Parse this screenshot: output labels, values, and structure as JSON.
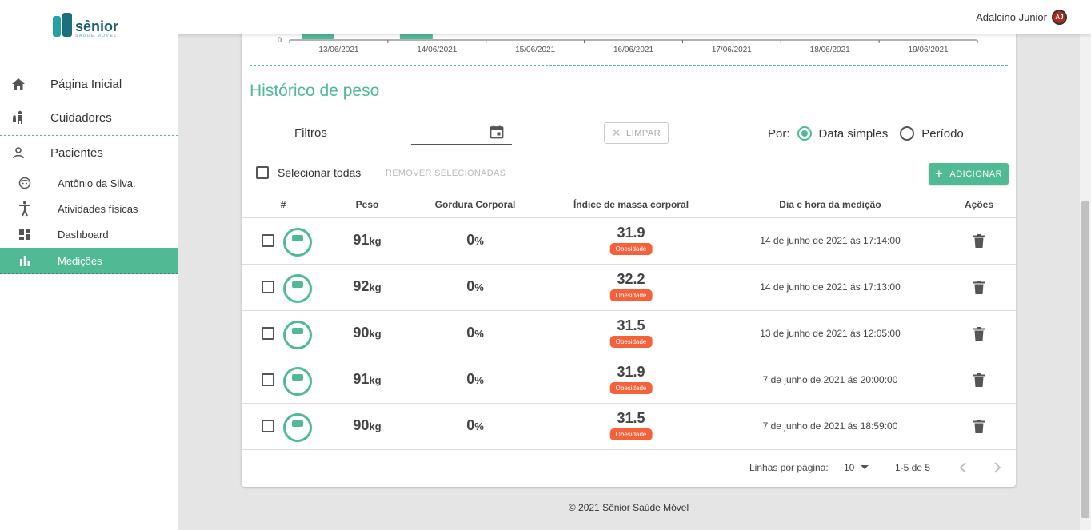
{
  "user": {
    "name": "Adalcino Junior",
    "initials": "AJ"
  },
  "logo": {
    "title": "sênior",
    "subtitle": "SAÚDE MÓVEL"
  },
  "sidebar": {
    "items": [
      {
        "label": "Página Inicial",
        "icon": "home-icon"
      },
      {
        "label": "Cuidadores",
        "icon": "caregivers-icon"
      },
      {
        "label": "Pacientes",
        "icon": "person-icon"
      }
    ],
    "sub_items": [
      {
        "label": "Antônio da Silva.",
        "icon": "face-icon"
      },
      {
        "label": "Atividades físicas",
        "icon": "activity-icon"
      },
      {
        "label": "Dashboard",
        "icon": "dashboard-icon"
      },
      {
        "label": "Medições",
        "icon": "bar-chart-icon",
        "active": true
      }
    ]
  },
  "chart_data": {
    "type": "bar",
    "categories": [
      "13/06/2021",
      "14/06/2021",
      "15/06/2021",
      "16/06/2021",
      "17/06/2021",
      "18/06/2021",
      "19/06/2021"
    ],
    "y_tick_label": "0",
    "bar_color": "#4fba93"
  },
  "section": {
    "title": "Histórico de peso"
  },
  "filters": {
    "label": "Filtros",
    "date_value": "",
    "clear_label": "LIMPAR",
    "by_label": "Por:",
    "options": [
      "Data simples",
      "Período"
    ],
    "selected": "Data simples"
  },
  "actions": {
    "select_all_label": "Selecionar todas",
    "remove_selected_label": "REMOVER SELECIONADAS",
    "add_label": "ADICIONAR"
  },
  "table": {
    "headers": [
      "#",
      "Peso",
      "Gordura Corporal",
      "Índice de massa corporal",
      "Dia e hora da medição",
      "Ações"
    ],
    "rows": [
      {
        "peso": "91",
        "unit": "kg",
        "gordura": "0",
        "gordura_unit": "%",
        "imc": "31.9",
        "imc_label": "Obesidade",
        "data": "14 de junho de 2021 ás 17:14:00"
      },
      {
        "peso": "92",
        "unit": "kg",
        "gordura": "0",
        "gordura_unit": "%",
        "imc": "32.2",
        "imc_label": "Obesidade",
        "data": "14 de junho de 2021 ás 17:13:00"
      },
      {
        "peso": "90",
        "unit": "kg",
        "gordura": "0",
        "gordura_unit": "%",
        "imc": "31.5",
        "imc_label": "Obesidade",
        "data": "13 de junho de 2021 ás 12:05:00"
      },
      {
        "peso": "91",
        "unit": "kg",
        "gordura": "0",
        "gordura_unit": "%",
        "imc": "31.9",
        "imc_label": "Obesidade",
        "data": "7 de junho de 2021 ás 20:00:00"
      },
      {
        "peso": "90",
        "unit": "kg",
        "gordura": "0",
        "gordura_unit": "%",
        "imc": "31.5",
        "imc_label": "Obesidade",
        "data": "7 de junho de 2021 ás 18:59:00"
      }
    ]
  },
  "pagination": {
    "rows_label": "Linhas por página:",
    "rows_value": "10",
    "range": "1-5 de 5"
  },
  "footer": {
    "text": "© 2021 Sênior Saúde Móvel"
  },
  "colors": {
    "accent": "#4fba93",
    "badge": "#f4613a",
    "avatar": "#b22a1a"
  }
}
